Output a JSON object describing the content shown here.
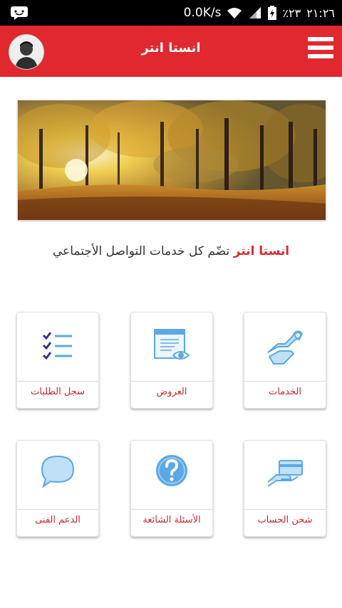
{
  "status_bar": {
    "speed": "0.0K/s",
    "battery_percent": "٪٢٣",
    "time": "٢١:٢٦",
    "icons": [
      "message-icon",
      "wifi-icon",
      "signal-icon",
      "battery-icon"
    ]
  },
  "header": {
    "title": "انستا انتر",
    "menu_icon": "hamburger-menu-icon",
    "avatar_icon": "profile-avatar"
  },
  "tagline": {
    "brand": "انستا انتر",
    "rest": " تضّم كل خدمات التواصل الأجتماعي"
  },
  "tiles": [
    {
      "label": "الخدمات",
      "icon": "wrench-hand-icon"
    },
    {
      "label": "العروض",
      "icon": "document-eye-icon"
    },
    {
      "label": "سجل الطلبات",
      "icon": "checklist-icon"
    },
    {
      "label": "شحن الحساب",
      "icon": "card-hand-icon"
    },
    {
      "label": "الأسئلة الشائعة",
      "icon": "question-icon"
    },
    {
      "label": "الدعم الفنى",
      "icon": "chat-bubble-icon"
    }
  ],
  "colors": {
    "brand_red": "#e0282e",
    "icon_blue": "#5aa9e6",
    "icon_navy": "#2b3a8c"
  }
}
